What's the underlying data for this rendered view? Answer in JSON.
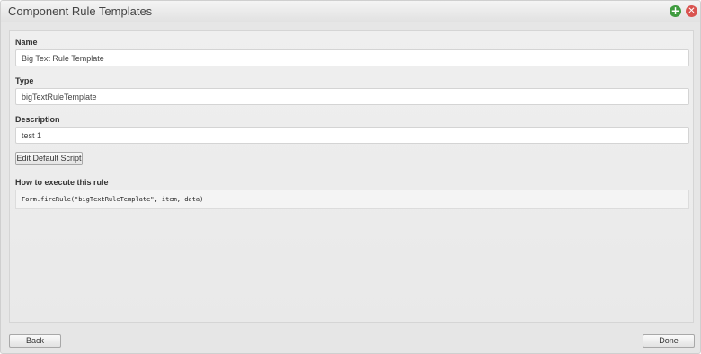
{
  "dialog": {
    "title": "Component Rule Templates",
    "add_icon": "plus-circle-icon",
    "close_icon": "close-circle-icon"
  },
  "form": {
    "name_label": "Name",
    "name_value": "Big Text Rule Template",
    "type_label": "Type",
    "type_value": "bigTextRuleTemplate",
    "description_label": "Description",
    "description_value": "test 1",
    "edit_script_label": "Edit Default Script",
    "how_to_label": "How to execute this rule",
    "how_to_code": "Form.fireRule(\"bigTextRuleTemplate\", item, data)"
  },
  "footer": {
    "back_label": "Back",
    "done_label": "Done"
  },
  "colors": {
    "add_icon": "#3e9b3e",
    "close_icon": "#d9534f"
  }
}
